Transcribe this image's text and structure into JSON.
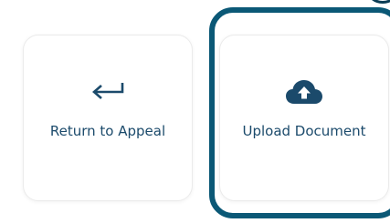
{
  "actions": [
    {
      "label": "Return to Appeal",
      "icon": "return-arrow-icon"
    },
    {
      "label": "Upload Document",
      "icon": "cloud-upload-icon"
    }
  ],
  "colors": {
    "icon": "#1b4a6b",
    "label": "#1b4a6b",
    "highlight": "#0b5876"
  }
}
